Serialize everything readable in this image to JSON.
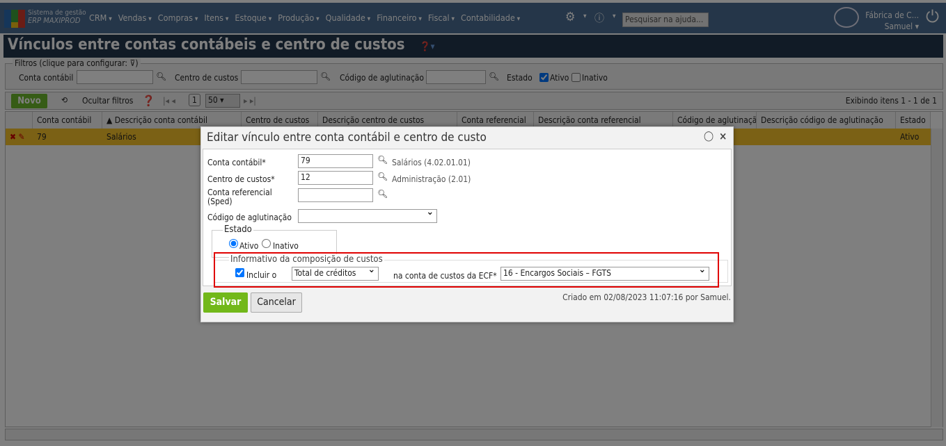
{
  "nav": {
    "brand_line1": "Sistema de gestão",
    "brand_line2": "ERP MAXIPROD",
    "menu": [
      "CRM",
      "Vendas",
      "Compras",
      "Itens",
      "Estoque",
      "Produção",
      "Qualidade",
      "Financeiro",
      "Fiscal",
      "Contabilidade"
    ],
    "help_search_placeholder": "Pesquisar na ajuda...",
    "company": "Fábrica de C...",
    "user": "Samuel"
  },
  "page": {
    "title": "Vínculos entre contas contábeis e centro de custos"
  },
  "filters": {
    "legend": "Filtros (clique para configurar:",
    "conta_label": "Conta contábil",
    "centro_label": "Centro de custos",
    "codigo_label": "Código de aglutinação",
    "estado_label": "Estado",
    "ativo": "Ativo",
    "inativo": "Inativo",
    "ativo_checked": true,
    "inativo_checked": false
  },
  "toolbar": {
    "novo": "Novo",
    "ocultar": "Ocultar filtros",
    "page": "1",
    "page_size": "50",
    "showing": "Exibindo itens 1 - 1 de 1"
  },
  "grid": {
    "columns": [
      "Conta contábil",
      "▲ Descrição conta contábil",
      "Centro de custos",
      "Descrição centro de custos",
      "Conta referencial",
      "Descrição conta referencial",
      "Código de aglutinação",
      "Descrição código de aglutinação",
      "Estado"
    ],
    "rows": [
      [
        "79",
        "Salários",
        "",
        "",
        "",
        "",
        "",
        "",
        "Ativo"
      ]
    ]
  },
  "modal": {
    "title": "Editar vínculo entre conta contábil e centro de custo",
    "conta_label": "Conta contábil*",
    "conta_value": "79",
    "conta_desc": "Salários (4.02.01.01)",
    "centro_label": "Centro de custos*",
    "centro_value": "12",
    "centro_desc": "Administração (2.01)",
    "ref_label1": "Conta referencial",
    "ref_label2": "(Sped)",
    "ref_value": "",
    "codigo_label": "Código de aglutinação",
    "codigo_value": "",
    "estado_legend": "Estado",
    "ativo": "Ativo",
    "inativo": "Inativo",
    "estado_selected": "Ativo",
    "info_legend": "Informativo da composição de custos",
    "incluir_label": "Incluir o",
    "incluir_checked": true,
    "incluir_value": "Total de créditos",
    "ecf_label": "na conta de custos da ECF*",
    "ecf_value": "16 - Encargos Sociais – FGTS",
    "save": "Salvar",
    "cancel": "Cancelar",
    "created": "Criado em 02/08/2023 11:07:16 por Samuel."
  },
  "colors": {
    "nav": "#4a6d92",
    "title": "#22364c",
    "accent_green": "#72b81a",
    "row_highlight": "#f6c22a",
    "highlight_box": "#e00000"
  }
}
